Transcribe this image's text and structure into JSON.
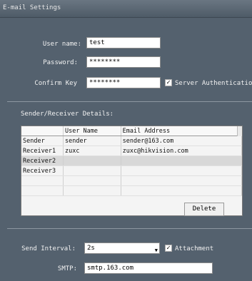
{
  "window": {
    "title": "E-mail Settings"
  },
  "form": {
    "user_name_label": "User name:",
    "user_name_value": "test",
    "password_label": "Password:",
    "password_value": "********",
    "confirm_label": "Confirm Key",
    "confirm_value": "********",
    "server_auth_label": "Server Authentication",
    "server_auth_checked": "✓"
  },
  "section": {
    "title": "Sender/Receiver Details:"
  },
  "table": {
    "columns": [
      "",
      "User Name",
      "Email Address"
    ],
    "rows": [
      {
        "label": "Sender",
        "name": "sender",
        "email": "sender@163.com"
      },
      {
        "label": "Receiver1",
        "name": "zuxc",
        "email": "zuxc@hikvision.com"
      },
      {
        "label": "Receiver2",
        "name": "",
        "email": ""
      },
      {
        "label": "Receiver3",
        "name": "",
        "email": ""
      }
    ]
  },
  "buttons": {
    "delete": "Delete"
  },
  "bottom": {
    "interval_label": "Send Interval:",
    "interval_value": "2s",
    "attachment_label": "Attachment",
    "attachment_checked": "✓",
    "smtp_label": "SMTP:",
    "smtp_value": "smtp.163.com"
  }
}
